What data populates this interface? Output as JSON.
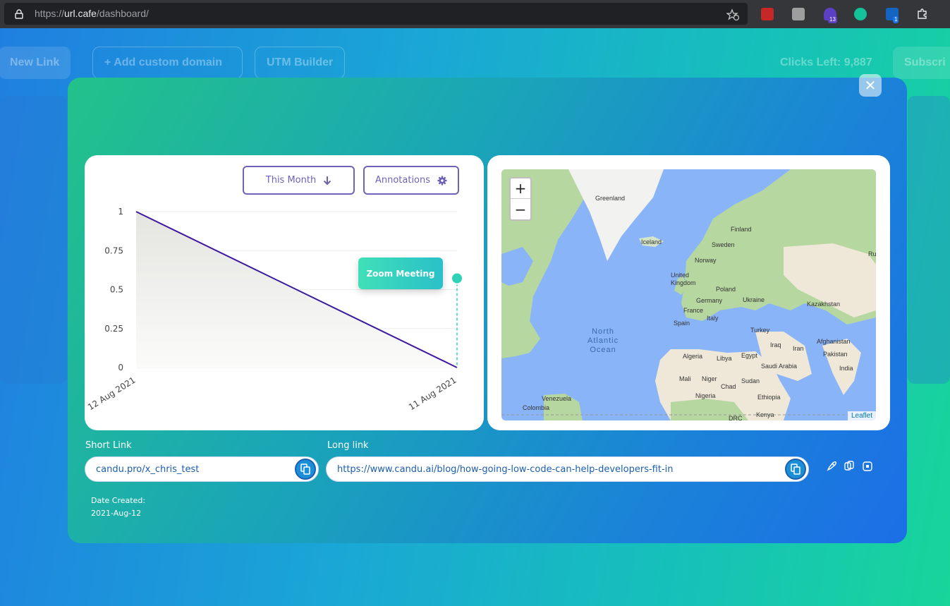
{
  "browser": {
    "url_scheme": "https://",
    "url_host": "url.cafe",
    "url_path": "/dashboard/",
    "extensions": [
      {
        "name": "ext-red",
        "color": "#c62828"
      },
      {
        "name": "ext-gray",
        "color": "#9e9e9e"
      },
      {
        "name": "ext-purple",
        "color": "#5c3fc2",
        "badge": "13"
      },
      {
        "name": "grammarly",
        "color": "#15c39a"
      },
      {
        "name": "ext-blue",
        "color": "#1565c0",
        "badge": "1"
      },
      {
        "name": "puzzle",
        "color": "#e8eaed"
      }
    ]
  },
  "background": {
    "new_link": "New Link",
    "add_custom_domain": "+ Add custom domain",
    "utm_builder": "UTM Builder",
    "clicks_left": "Clicks Left: 9,887",
    "subscribe": "Subscri"
  },
  "modal": {
    "close_symbol": "✕",
    "controls": {
      "range_label": "This Month",
      "annotations_label": "Annotations"
    },
    "annotation_tip": "Zoom Meeting",
    "map": {
      "zoom_in": "+",
      "zoom_out": "−",
      "attribution": "Leaflet",
      "ocean": [
        "North",
        "Atlantic",
        "Ocean"
      ],
      "labels": [
        "Greenland",
        "Iceland",
        "Finland",
        "Sweden",
        "Norway",
        "United Kingdom",
        "Poland",
        "Germany",
        "Ukraine",
        "France",
        "Spain",
        "Italy",
        "Kazakhstan",
        "Turkey",
        "Iraq",
        "Iran",
        "Afghanistan",
        "Pakistan",
        "India",
        "Algeria",
        "Libya",
        "Egypt",
        "Saudi Arabia",
        "Mali",
        "Niger",
        "Chad",
        "Sudan",
        "Ethiopia",
        "Nigeria",
        "Kenya",
        "Venezuela",
        "Colombia",
        "Ru",
        "DRC"
      ]
    },
    "short_link_label": "Short Link",
    "short_link_value": "candu.pro/x_chris_test",
    "long_link_label": "Long link",
    "long_link_value": "https://www.candu.ai/blog/how-going-low-code-can-help-developers-fit-in",
    "date_created_label": "Date Created:",
    "date_created_value": "2021-Aug-12"
  },
  "chart_data": {
    "type": "area",
    "x": [
      "12 Aug 2021",
      "11 Aug 2021"
    ],
    "values": [
      1,
      0
    ],
    "ylim": [
      0,
      1
    ],
    "yticks": [
      "1",
      "0.75",
      "0.5",
      "0.25",
      "0"
    ],
    "line_color": "#3b1a9e",
    "annotation": {
      "label": "Zoom Meeting",
      "x": "11 Aug 2021",
      "y": 0.5,
      "color": "#2ed3b7"
    }
  }
}
